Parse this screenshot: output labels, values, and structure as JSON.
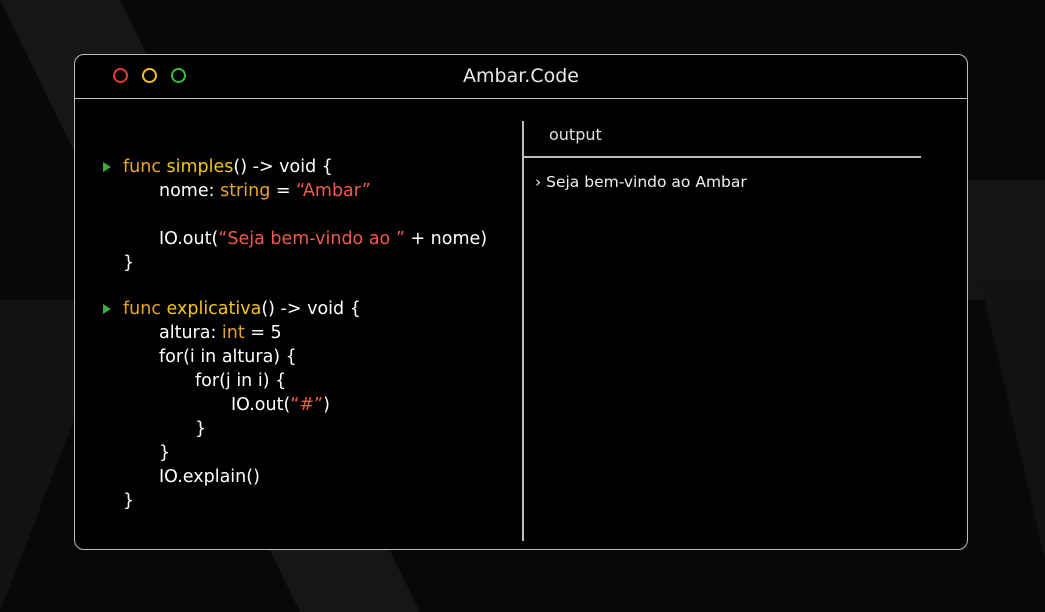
{
  "window": {
    "title": "Ambar.Code",
    "controls": {
      "close_color": "#e23b3b",
      "minimize_color": "#f2c21b",
      "maximize_color": "#3bbd3b"
    }
  },
  "editor": {
    "lines": [
      {
        "run": true,
        "indent": 0,
        "tokens": [
          {
            "t": "func ",
            "c": "kw"
          },
          {
            "t": "simples",
            "c": "fn"
          },
          {
            "t": "() -> void {",
            "c": "pl"
          }
        ]
      },
      {
        "run": false,
        "indent": 1,
        "tokens": [
          {
            "t": "nome: ",
            "c": "pl"
          },
          {
            "t": "string",
            "c": "ty"
          },
          {
            "t": " = ",
            "c": "pl"
          },
          {
            "t": "“Ambar”",
            "c": "str"
          }
        ]
      },
      {
        "run": false,
        "indent": 1,
        "tokens": []
      },
      {
        "run": false,
        "indent": 1,
        "tokens": [
          {
            "t": "IO.out(",
            "c": "pl"
          },
          {
            "t": "“Seja bem-vindo ao ”",
            "c": "str"
          },
          {
            "t": " + nome)",
            "c": "pl"
          }
        ]
      },
      {
        "run": false,
        "indent": 0,
        "tokens": [
          {
            "t": "}",
            "c": "pl"
          }
        ]
      },
      {
        "run": false,
        "indent": 0,
        "tokens": []
      },
      {
        "run": true,
        "indent": 0,
        "tokens": [
          {
            "t": "func ",
            "c": "kw"
          },
          {
            "t": "explicativa",
            "c": "fn"
          },
          {
            "t": "() -> void {",
            "c": "pl"
          }
        ]
      },
      {
        "run": false,
        "indent": 1,
        "tokens": [
          {
            "t": "altura: ",
            "c": "pl"
          },
          {
            "t": "int",
            "c": "ty"
          },
          {
            "t": " = 5",
            "c": "pl"
          }
        ]
      },
      {
        "run": false,
        "indent": 1,
        "tokens": [
          {
            "t": "for(i in altura) {",
            "c": "pl"
          }
        ]
      },
      {
        "run": false,
        "indent": 2,
        "tokens": [
          {
            "t": "for(j in i) {",
            "c": "pl"
          }
        ]
      },
      {
        "run": false,
        "indent": 3,
        "tokens": [
          {
            "t": "IO.out(",
            "c": "pl"
          },
          {
            "t": "“#”",
            "c": "str"
          },
          {
            "t": ")",
            "c": "pl"
          }
        ]
      },
      {
        "run": false,
        "indent": 2,
        "tokens": [
          {
            "t": "}",
            "c": "pl"
          }
        ]
      },
      {
        "run": false,
        "indent": 1,
        "tokens": [
          {
            "t": "}",
            "c": "pl"
          }
        ]
      },
      {
        "run": false,
        "indent": 1,
        "tokens": [
          {
            "t": "IO.explain()",
            "c": "pl"
          }
        ]
      },
      {
        "run": false,
        "indent": 0,
        "tokens": [
          {
            "t": "}",
            "c": "pl"
          }
        ]
      }
    ]
  },
  "output": {
    "header": "output",
    "lines": [
      "› Seja bem-vindo ao Ambar"
    ]
  },
  "icons": {
    "run": "play-triangle-icon"
  },
  "colors": {
    "keyword": "#e8a52d",
    "function_name": "#f5c518",
    "string": "#f15a4a",
    "run_icon": "#3fae3f",
    "border": "#bdbdbd"
  }
}
